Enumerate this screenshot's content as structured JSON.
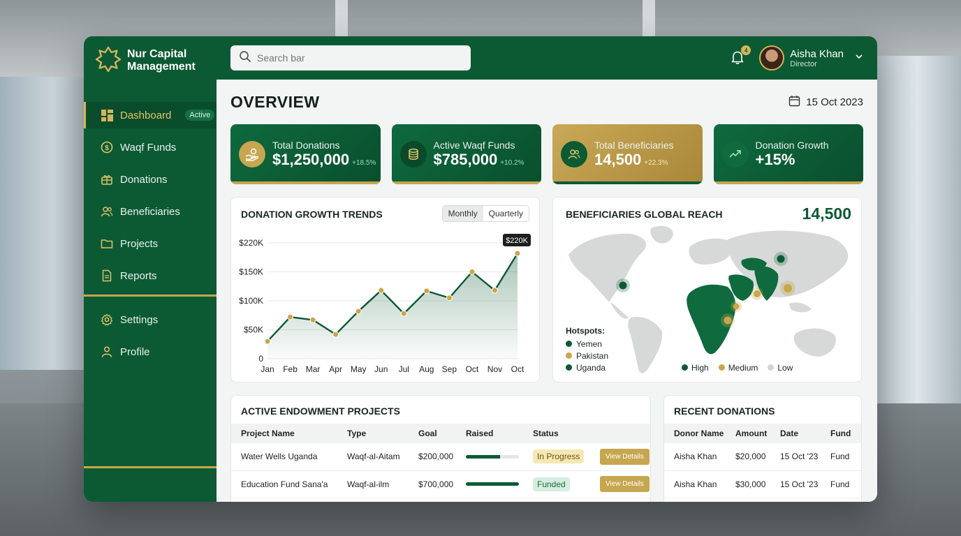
{
  "brand": {
    "name_line1": "Nur Capital",
    "name_line2": "Management"
  },
  "sidebar": {
    "items": [
      {
        "label": "Dashboard",
        "icon": "dashboard-icon",
        "badge": "Active"
      },
      {
        "label": "Waqf Funds",
        "icon": "dollar-coin-icon"
      },
      {
        "label": "Donations",
        "icon": "gift-box-icon"
      },
      {
        "label": "Beneficiaries",
        "icon": "users-icon"
      },
      {
        "label": "Projects",
        "icon": "folder-icon"
      },
      {
        "label": "Reports",
        "icon": "document-icon"
      },
      {
        "label": "Settings",
        "icon": "gear-icon"
      },
      {
        "label": "Profile",
        "icon": "user-icon"
      }
    ]
  },
  "search": {
    "placeholder": "Search bar"
  },
  "notifications": {
    "count": "4"
  },
  "user": {
    "name": "Aisha Khan",
    "role": "Director"
  },
  "page": {
    "title": "OVERVIEW",
    "date": "15 Oct 2023"
  },
  "stats": [
    {
      "label": "Total Donations",
      "value": "$1,250,000",
      "delta": "+18.5%",
      "icon": "hand-coin-icon"
    },
    {
      "label": "Active Waqf Funds",
      "value": "$785,000",
      "delta": "+10.2%",
      "icon": "coin-stack-icon"
    },
    {
      "label": "Total Beneficiaries",
      "value": "14,500",
      "delta": "+22.3%",
      "icon": "people-icon"
    },
    {
      "label": "Donation Growth",
      "value": "+15%",
      "delta": "",
      "icon": "trend-up-icon"
    }
  ],
  "trend": {
    "title": "DONATION GROWTH TRENDS",
    "toggle": [
      "Monthly",
      "Quarterly"
    ],
    "tooltip": "$220K"
  },
  "chart_data": {
    "type": "area",
    "title": "DONATION GROWTH TRENDS",
    "categories": [
      "Jan",
      "Feb",
      "Mar",
      "Apr",
      "May",
      "Jun",
      "Jul",
      "Aug",
      "Sep",
      "Oct",
      "Nov",
      "Oct"
    ],
    "values": [
      30,
      72,
      67,
      42,
      82,
      118,
      78,
      117,
      105,
      150,
      118,
      182
    ],
    "unit": "$K",
    "yticks": [
      "0",
      "$50K",
      "$100K",
      "$150K",
      "$220K"
    ],
    "ytick_values": [
      0,
      50,
      100,
      150,
      200
    ],
    "ylim": [
      0,
      200
    ],
    "annotation": {
      "label": "$220K",
      "index": 11
    },
    "colors": {
      "line": "#0c5a34",
      "marker": "#c8a64a",
      "fill": "#0c5a34"
    }
  },
  "reach": {
    "title": "BENEFICIARIES GLOBAL REACH",
    "total": "14,500",
    "hotspots_title": "Hotspots:",
    "hotspots": [
      {
        "name": "Yemen",
        "color": "#0c5a34"
      },
      {
        "name": "Pakistan",
        "color": "#c8a64a"
      },
      {
        "name": "Uganda",
        "color": "#0c5a34"
      }
    ],
    "legend": [
      {
        "name": "High",
        "color": "#0c5a34"
      },
      {
        "name": "Medium",
        "color": "#c8a64a"
      },
      {
        "name": "Low",
        "color": "#d3d6d4"
      }
    ]
  },
  "projects": {
    "title": "ACTIVE ENDOWMENT PROJECTS",
    "columns": [
      "Project Name",
      "Type",
      "Goal",
      "Raised",
      "Status",
      ""
    ],
    "rows": [
      {
        "name": "Water Wells Uganda",
        "type": "Waqf-al-Aitam",
        "goal": "$200,000",
        "raised_fraction": 0.65,
        "status": "In Progress",
        "action": "View Details"
      },
      {
        "name": "Education Fund Sana'a",
        "type": "Waqf-al-ilm",
        "goal": "$700,000",
        "raised_fraction": 1.0,
        "status": "Funded",
        "action": "View Details"
      }
    ]
  },
  "donations": {
    "title": "RECENT DONATIONS",
    "columns": [
      "Donor Name",
      "Amount",
      "Date",
      "Fund"
    ],
    "rows": [
      {
        "donor": "Aisha Khan",
        "amount": "$20,000",
        "date": "15 Oct '23",
        "fund": "Fund"
      },
      {
        "donor": "Aisha Khan",
        "amount": "$30,000",
        "date": "15 Oct '23",
        "fund": "Fund"
      }
    ]
  },
  "colors": {
    "primary": "#0c5a34",
    "gold": "#c8a64a"
  }
}
